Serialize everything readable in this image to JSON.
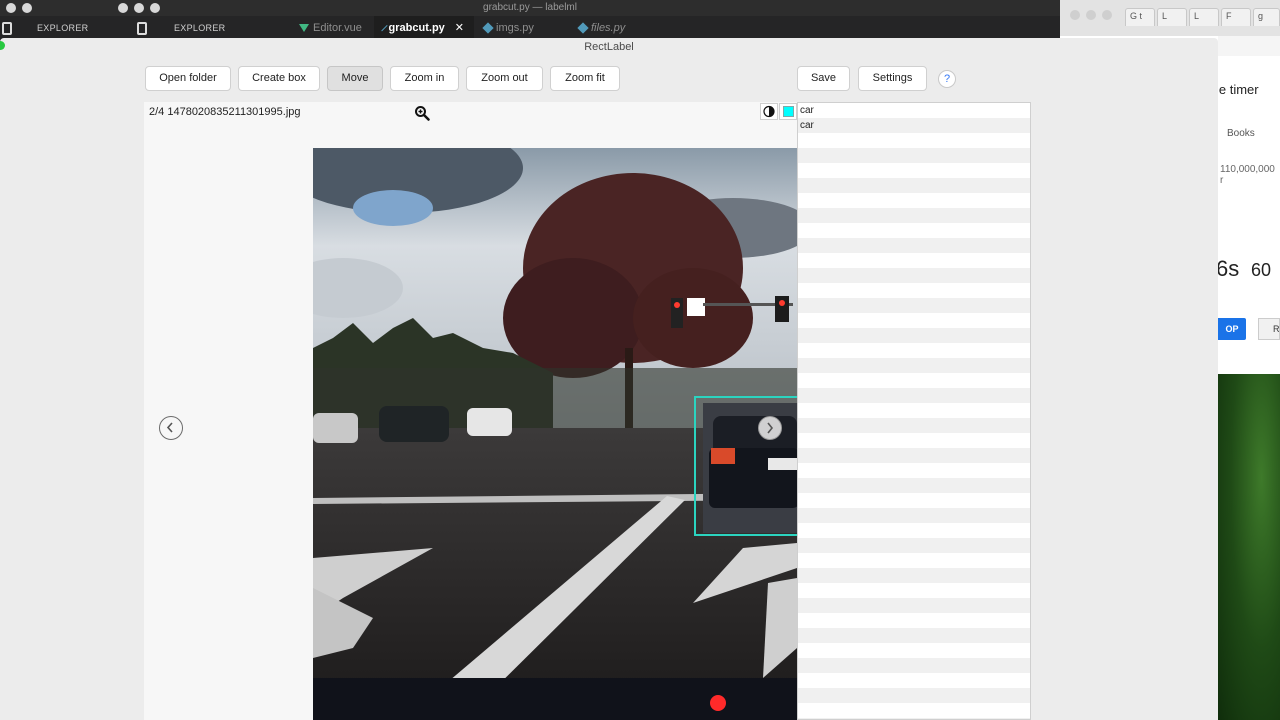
{
  "background_editor": {
    "window_title": "grabcut.py — labelml",
    "explorer_labels": [
      "EXPLORER",
      "EXPLORER"
    ],
    "tabs": [
      {
        "label": "Editor.vue",
        "active": false,
        "italic": false
      },
      {
        "label": "grabcut.py",
        "active": true,
        "italic": false
      },
      {
        "label": "imgs.py",
        "active": false,
        "italic": false
      },
      {
        "label": "files.py",
        "active": false,
        "italic": true
      }
    ]
  },
  "chrome": {
    "tabs": [
      "G t",
      "L",
      "L",
      "F",
      "g"
    ],
    "title_fragment": "le timer",
    "books_label": "Books",
    "results_fragment": "110,000,000 r",
    "timer_fragment": "6s",
    "timer_value": "60",
    "button_fragment": "OP",
    "button2_fragment": "R"
  },
  "app": {
    "title": "RectLabel",
    "toolbar": {
      "open_folder": "Open folder",
      "create_box": "Create box",
      "move": "Move",
      "zoom_in": "Zoom in",
      "zoom_out": "Zoom out",
      "zoom_fit": "Zoom fit",
      "save": "Save",
      "settings": "Settings",
      "help": "?"
    },
    "image_info": "2/4 1478020835211301995.jpg",
    "labels": [
      "car",
      "car"
    ],
    "box_color": "#00ffff",
    "bbox_color": "#2bd4c0"
  }
}
